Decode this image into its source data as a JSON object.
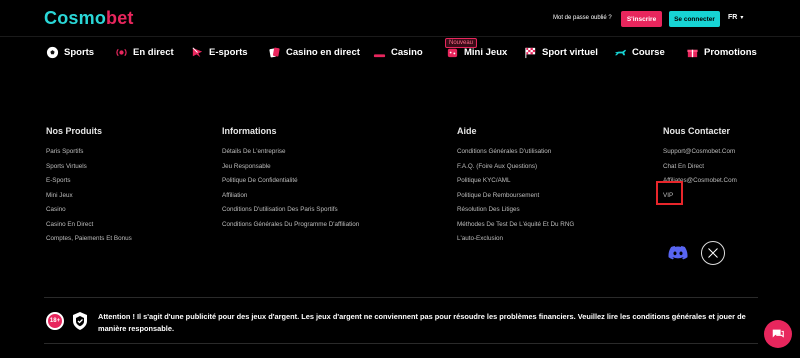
{
  "header": {
    "logo_part1": "C",
    "logo_o": "o",
    "logo_part2": "smo",
    "logo_part3": "bet",
    "forgot_password": "Mot de passe oublié ?",
    "signup": "S'inscrire",
    "login": "Se connecter",
    "language": "FR"
  },
  "nav": {
    "new_badge": "Nouveau",
    "items": [
      {
        "label": "Sports",
        "icon": "soccer-ball-icon"
      },
      {
        "label": "En direct",
        "icon": "live-icon"
      },
      {
        "label": "E-sports",
        "icon": "esports-icon"
      },
      {
        "label": "Casino en direct",
        "icon": "cards-icon"
      },
      {
        "label": "Casino",
        "icon": "slot-icon"
      },
      {
        "label": "Mini Jeux",
        "icon": "mini-games-icon"
      },
      {
        "label": "Sport virtuel",
        "icon": "checkered-flag-icon"
      },
      {
        "label": "Course",
        "icon": "greyhound-icon"
      },
      {
        "label": "Promotions",
        "icon": "gift-icon"
      }
    ]
  },
  "footer": {
    "products": {
      "title": "Nos Produits",
      "items": [
        "Paris Sportifs",
        "Sports Virtuels",
        "E-Sports",
        "Mini Jeux",
        "Casino",
        "Casino En Direct",
        "Comptes, Paiements Et Bonus"
      ]
    },
    "information": {
      "title": "Informations",
      "items": [
        "Détails De L'entreprise",
        "Jeu Responsable",
        "Politique De Confidentialité",
        "Affiliation",
        "Conditions D'utilisation Des Paris Sportifs",
        "Conditions Générales Du Programme D'affiliation"
      ]
    },
    "help": {
      "title": "Aide",
      "items": [
        "Conditions Générales D'utilisation",
        "F.A.Q. (Foire Aux Questions)",
        "Politique KYC/AML",
        "Politique De Remboursement",
        "Résolution Des Litiges",
        "Méthodes De Test De L'équité Et Du RNG",
        "L'auto-Exclusion"
      ]
    },
    "contact": {
      "title": "Nous Contacter",
      "items": [
        "Support@Cosmobet.Com",
        "Chat En Direct",
        "Affiliates@Cosmobet.Com",
        "VIP"
      ]
    },
    "age_badge": "18+",
    "warning": "Attention ! Il s'agit d'une publicité pour des jeux d'argent. Les jeux d'argent ne conviennent pas pour résoudre les problèmes financiers. Veuillez lire les conditions générales et jouer de manière responsable."
  },
  "colors": {
    "brand_pink": "#e8265d",
    "brand_cyan": "#17d4d4",
    "highlight_red": "#e8262b"
  }
}
